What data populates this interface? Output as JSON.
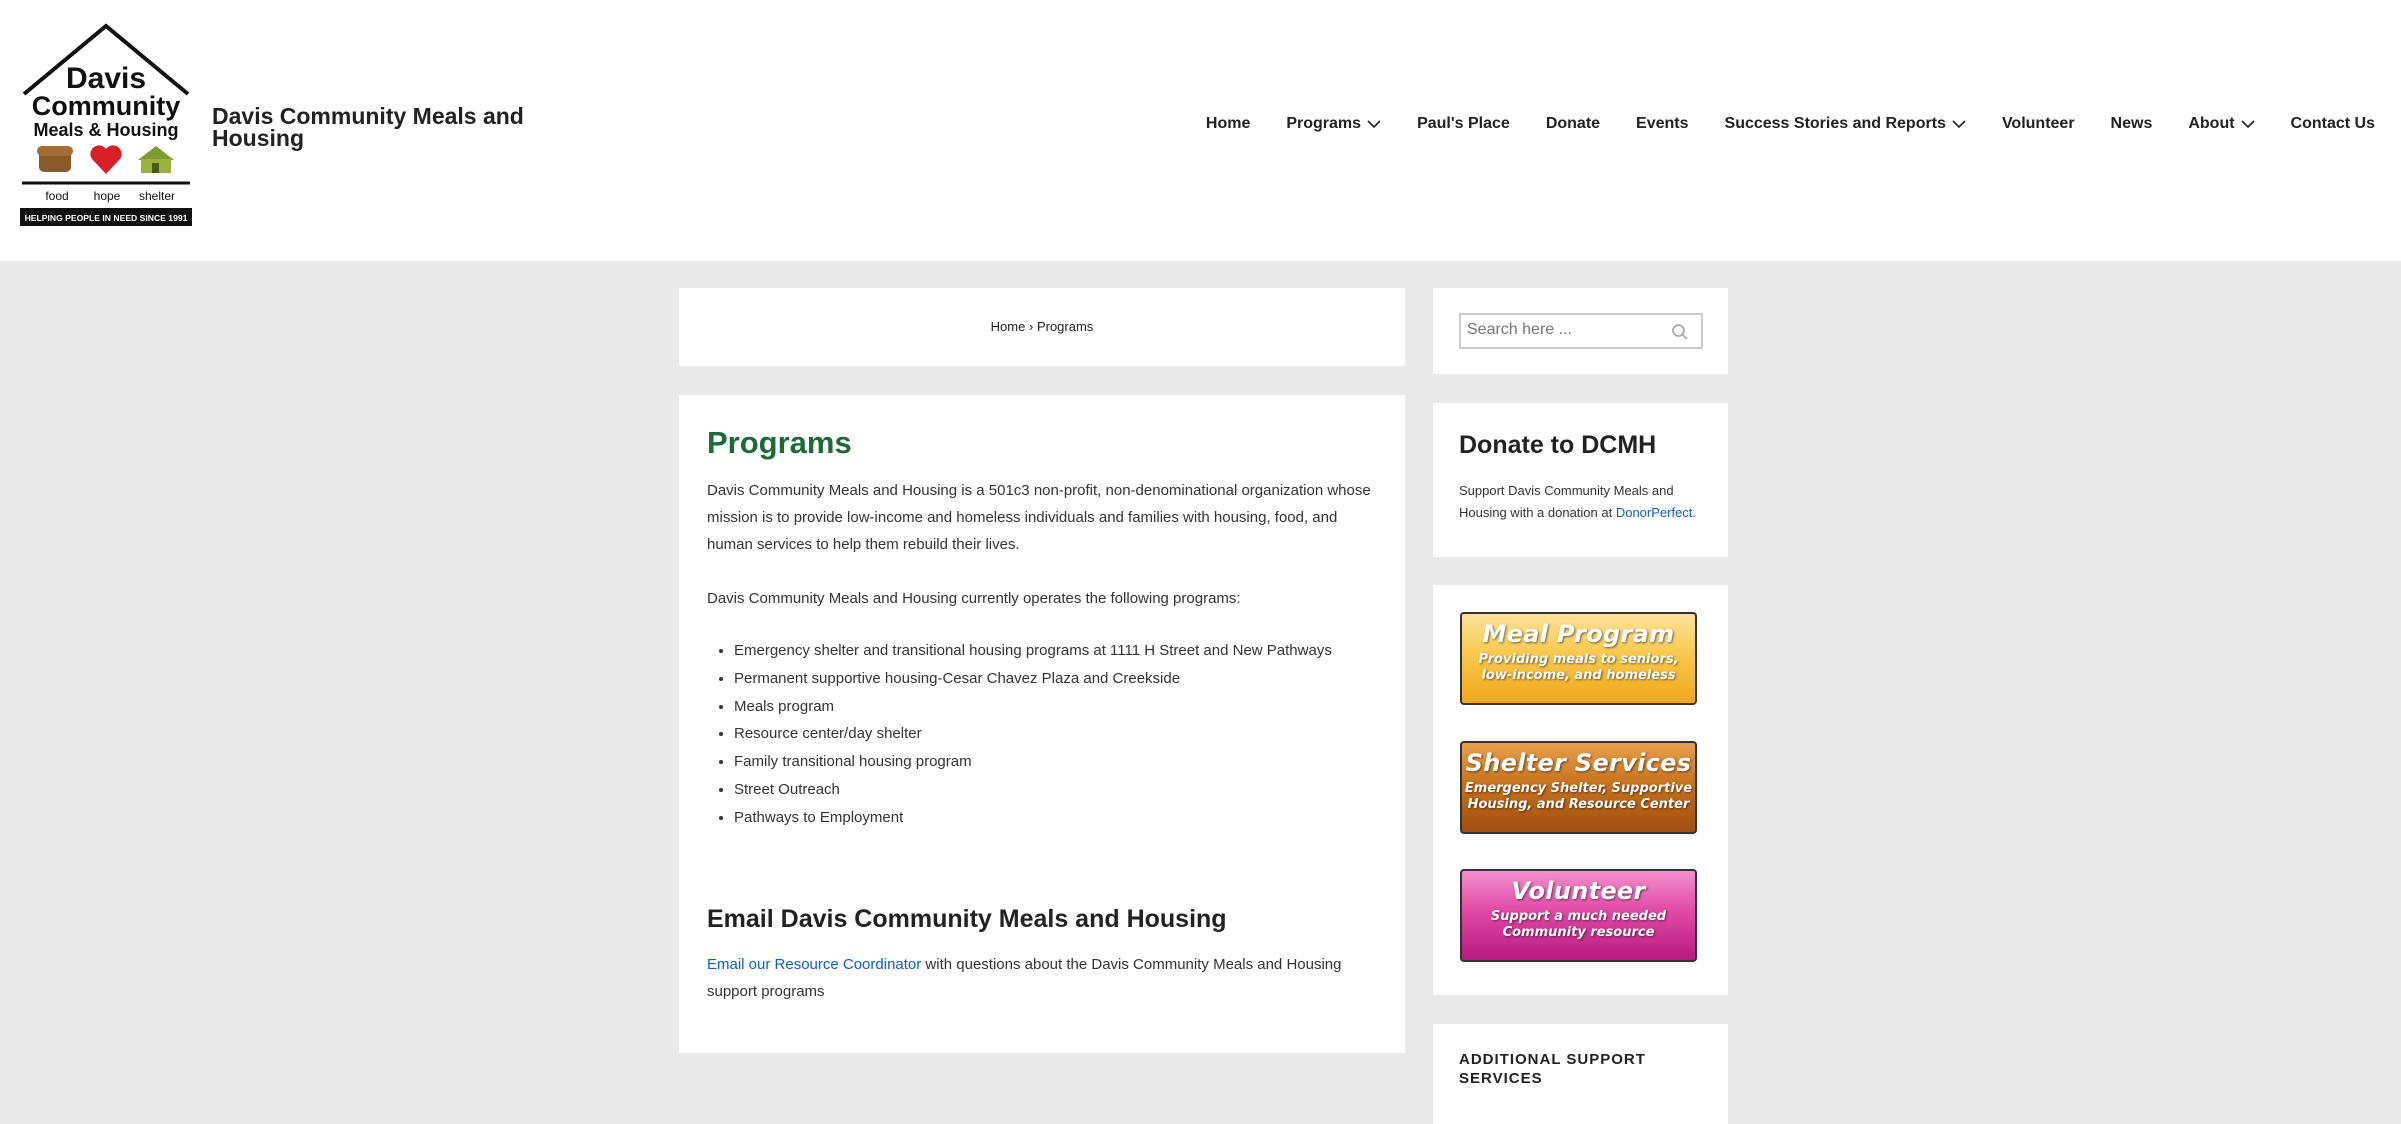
{
  "header": {
    "logo": {
      "name_line1": "Davis",
      "name_line2": "Community",
      "name_line3": "Meals & Housing",
      "tag_food": "food",
      "tag_hope": "hope",
      "tag_shelter": "shelter",
      "banner": "HELPING PEOPLE IN NEED SINCE 1991"
    },
    "site_title": "Davis Community Meals and Housing"
  },
  "nav": {
    "home": "Home",
    "programs": "Programs",
    "pauls_place": "Paul's Place",
    "donate": "Donate",
    "events": "Events",
    "success": "Success Stories and Reports",
    "volunteer": "Volunteer",
    "news": "News",
    "about": "About",
    "contact": "Contact Us"
  },
  "breadcrumb": {
    "home": "Home",
    "separator": "›",
    "current": "Programs"
  },
  "main": {
    "title": "Programs",
    "intro": "Davis Community Meals and Housing is a 501c3 non-profit, non-denominational organization whose mission is to provide low-income and homeless individuals and families with housing, food, and human services to help them rebuild their lives.",
    "operates": "Davis Community Meals and Housing currently operates the following programs:",
    "programs": [
      "Emergency shelter and transitional housing programs at 1111 H Street and New Pathways",
      "Permanent supportive housing-Cesar Chavez Plaza and Creekside",
      "Meals program",
      "Resource center/day shelter",
      "Family transitional housing program",
      "Street Outreach",
      "Pathways to Employment"
    ],
    "email_heading": "Email Davis Community Meals and Housing",
    "email_link": "Email our Resource Coordinator",
    "email_rest": " with questions about the Davis Community Meals and Housing support programs"
  },
  "sidebar": {
    "search_placeholder": "Search here ...",
    "donate_title": "Donate to DCMH",
    "donate_text": "Support Davis Community Meals and Housing with a donation at ",
    "donate_link": "DonorPerfect",
    "donate_end": ".",
    "banners": {
      "meal_title": "Meal Program",
      "meal_sub1": "Providing meals to seniors,",
      "meal_sub2": "low-income, and homeless",
      "shelter_title": "Shelter Services",
      "shelter_sub1": "Emergency Shelter, Supportive",
      "shelter_sub2": "Housing, and Resource Center",
      "volunteer_title": "Volunteer",
      "volunteer_sub1": "Support a much needed",
      "volunteer_sub2": "Community resource"
    },
    "support_title": "ADDITIONAL SUPPORT SERVICES"
  },
  "colors": {
    "title_green": "#1a6b36",
    "link_blue": "#0d5ec2",
    "page_bg": "#e9e9e9"
  }
}
